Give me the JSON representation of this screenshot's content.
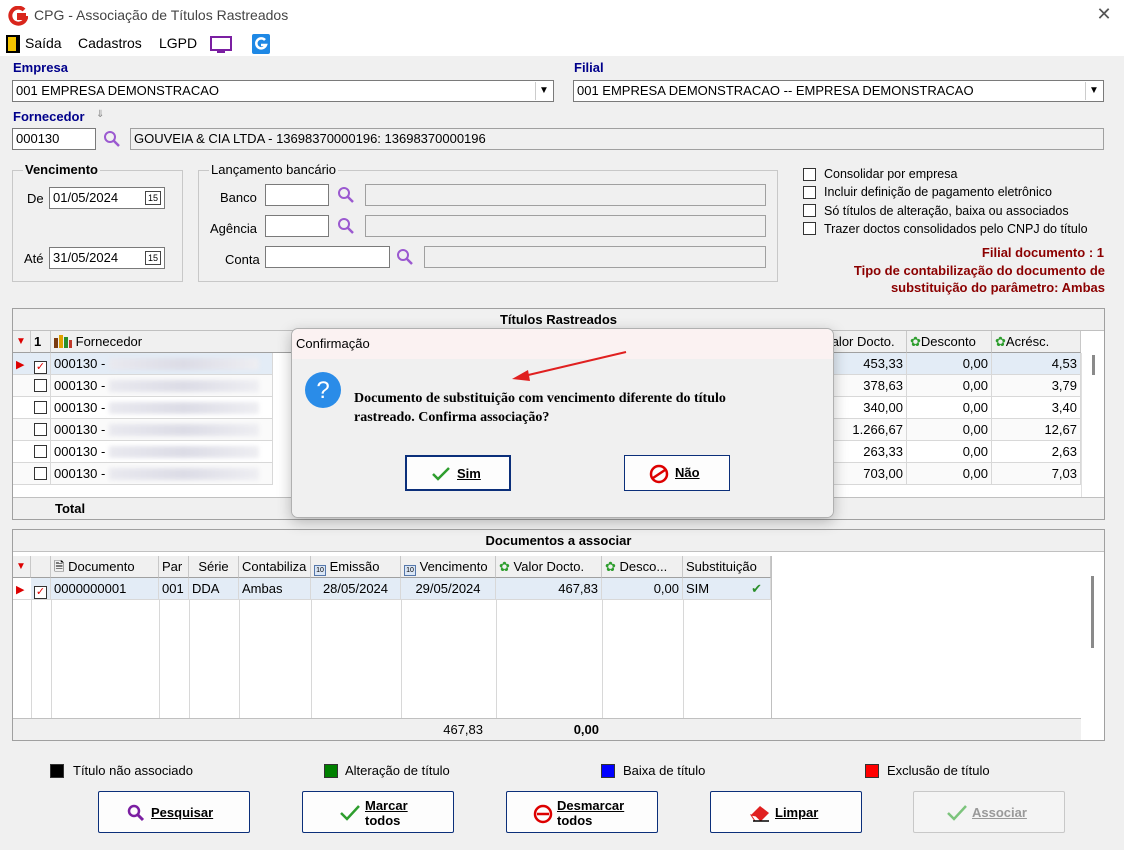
{
  "window": {
    "title": "CPG - Associação de Títulos Rastreados",
    "close_glyph": "✕"
  },
  "menu": {
    "items": [
      "Saída",
      "Cadastros",
      "LGPD"
    ]
  },
  "empresa": {
    "label": "Empresa",
    "value": "001 EMPRESA DEMONSTRACAO"
  },
  "filial": {
    "label": "Filial",
    "value": "001 EMPRESA DEMONSTRACAO -- EMPRESA DEMONSTRACAO"
  },
  "fornecedor": {
    "label": "Fornecedor",
    "code": "000130",
    "description": "GOUVEIA & CIA LTDA - 13698370000196: 13698370000196"
  },
  "vencimento": {
    "legend": "Vencimento",
    "de_label": "De",
    "de_value": "01/05/2024",
    "ate_label": "Até",
    "ate_value": "31/05/2024"
  },
  "lancamento": {
    "legend": "Lançamento bancário",
    "banco_label": "Banco",
    "agencia_label": "Agência",
    "conta_label": "Conta"
  },
  "options": [
    "Consolidar por empresa",
    "Incluir definição de pagamento eletrônico",
    "Só títulos de alteração, baixa ou associados",
    "Trazer doctos consolidados pelo CNPJ do título"
  ],
  "info": {
    "filial_doc": "Filial documento : 1",
    "tipo_line1": "Tipo de contabilização do documento de",
    "tipo_line2": "substituição do parâmetro: Ambas"
  },
  "titulos": {
    "title": "Títulos Rastreados",
    "sort_indicator": "1",
    "headers": {
      "fornecedor": "Fornecedor",
      "valor": "Valor Docto.",
      "desconto": "Desconto",
      "acresc": "Acrésc."
    },
    "rows": [
      {
        "code": "000130 -",
        "checked": true,
        "valor": "453,33",
        "desconto": "0,00",
        "acresc": "4,53"
      },
      {
        "code": "000130 -",
        "checked": false,
        "valor": "378,63",
        "desconto": "0,00",
        "acresc": "3,79"
      },
      {
        "code": "000130 -",
        "checked": false,
        "valor": "340,00",
        "desconto": "0,00",
        "acresc": "3,40"
      },
      {
        "code": "000130 -",
        "checked": false,
        "valor": "1.266,67",
        "desconto": "0,00",
        "acresc": "12,67"
      },
      {
        "code": "000130 -",
        "checked": false,
        "valor": "263,33",
        "desconto": "0,00",
        "acresc": "2,63"
      },
      {
        "code": "000130 -",
        "checked": false,
        "valor": "703,00",
        "desconto": "0,00",
        "acresc": "7,03"
      }
    ],
    "total_label": "Total"
  },
  "documentos": {
    "title": "Documentos a associar",
    "headers": {
      "documento": "Documento",
      "par": "Par",
      "serie": "Série",
      "contabiliza": "Contabiliza",
      "emissao": "Emissão",
      "vencimento": "Vencimento",
      "valor": "Valor Docto.",
      "desconto": "Desco...",
      "substituicao": "Substituição"
    },
    "rows": [
      {
        "documento": "0000000001",
        "par": "001",
        "serie": "DDA",
        "contabiliza": "Ambas",
        "emissao": "28/05/2024",
        "vencimento": "29/05/2024",
        "valor": "467,83",
        "desconto": "0,00",
        "substituicao": "SIM",
        "checked": true
      }
    ],
    "total_valor": "467,83",
    "total_desconto": "0,00"
  },
  "legend": {
    "items": [
      {
        "label": "Título não associado",
        "color": "#000000"
      },
      {
        "label": "Alteração de título",
        "color": "#008000"
      },
      {
        "label": "Baixa de título",
        "color": "#0000ff"
      },
      {
        "label": "Exclusão de título",
        "color": "#ff0000"
      }
    ]
  },
  "buttons": {
    "pesquisar": "Pesquisar",
    "marcar_l1": "Marcar",
    "marcar_l2": "todos",
    "desmarcar_l1": "Desmarcar",
    "desmarcar_l2": "todos",
    "limpar": "Limpar",
    "associar": "Associar"
  },
  "dialog": {
    "title": "Confirmação",
    "line1": "Documento de substituição com vencimento diferente do título",
    "line2": "rastreado. Confirma associação?",
    "sim": "Sim",
    "nao": "Não"
  },
  "colors": {
    "accent_blue": "#00008b",
    "info_red": "#8b0000",
    "app_red": "#d9261c"
  }
}
